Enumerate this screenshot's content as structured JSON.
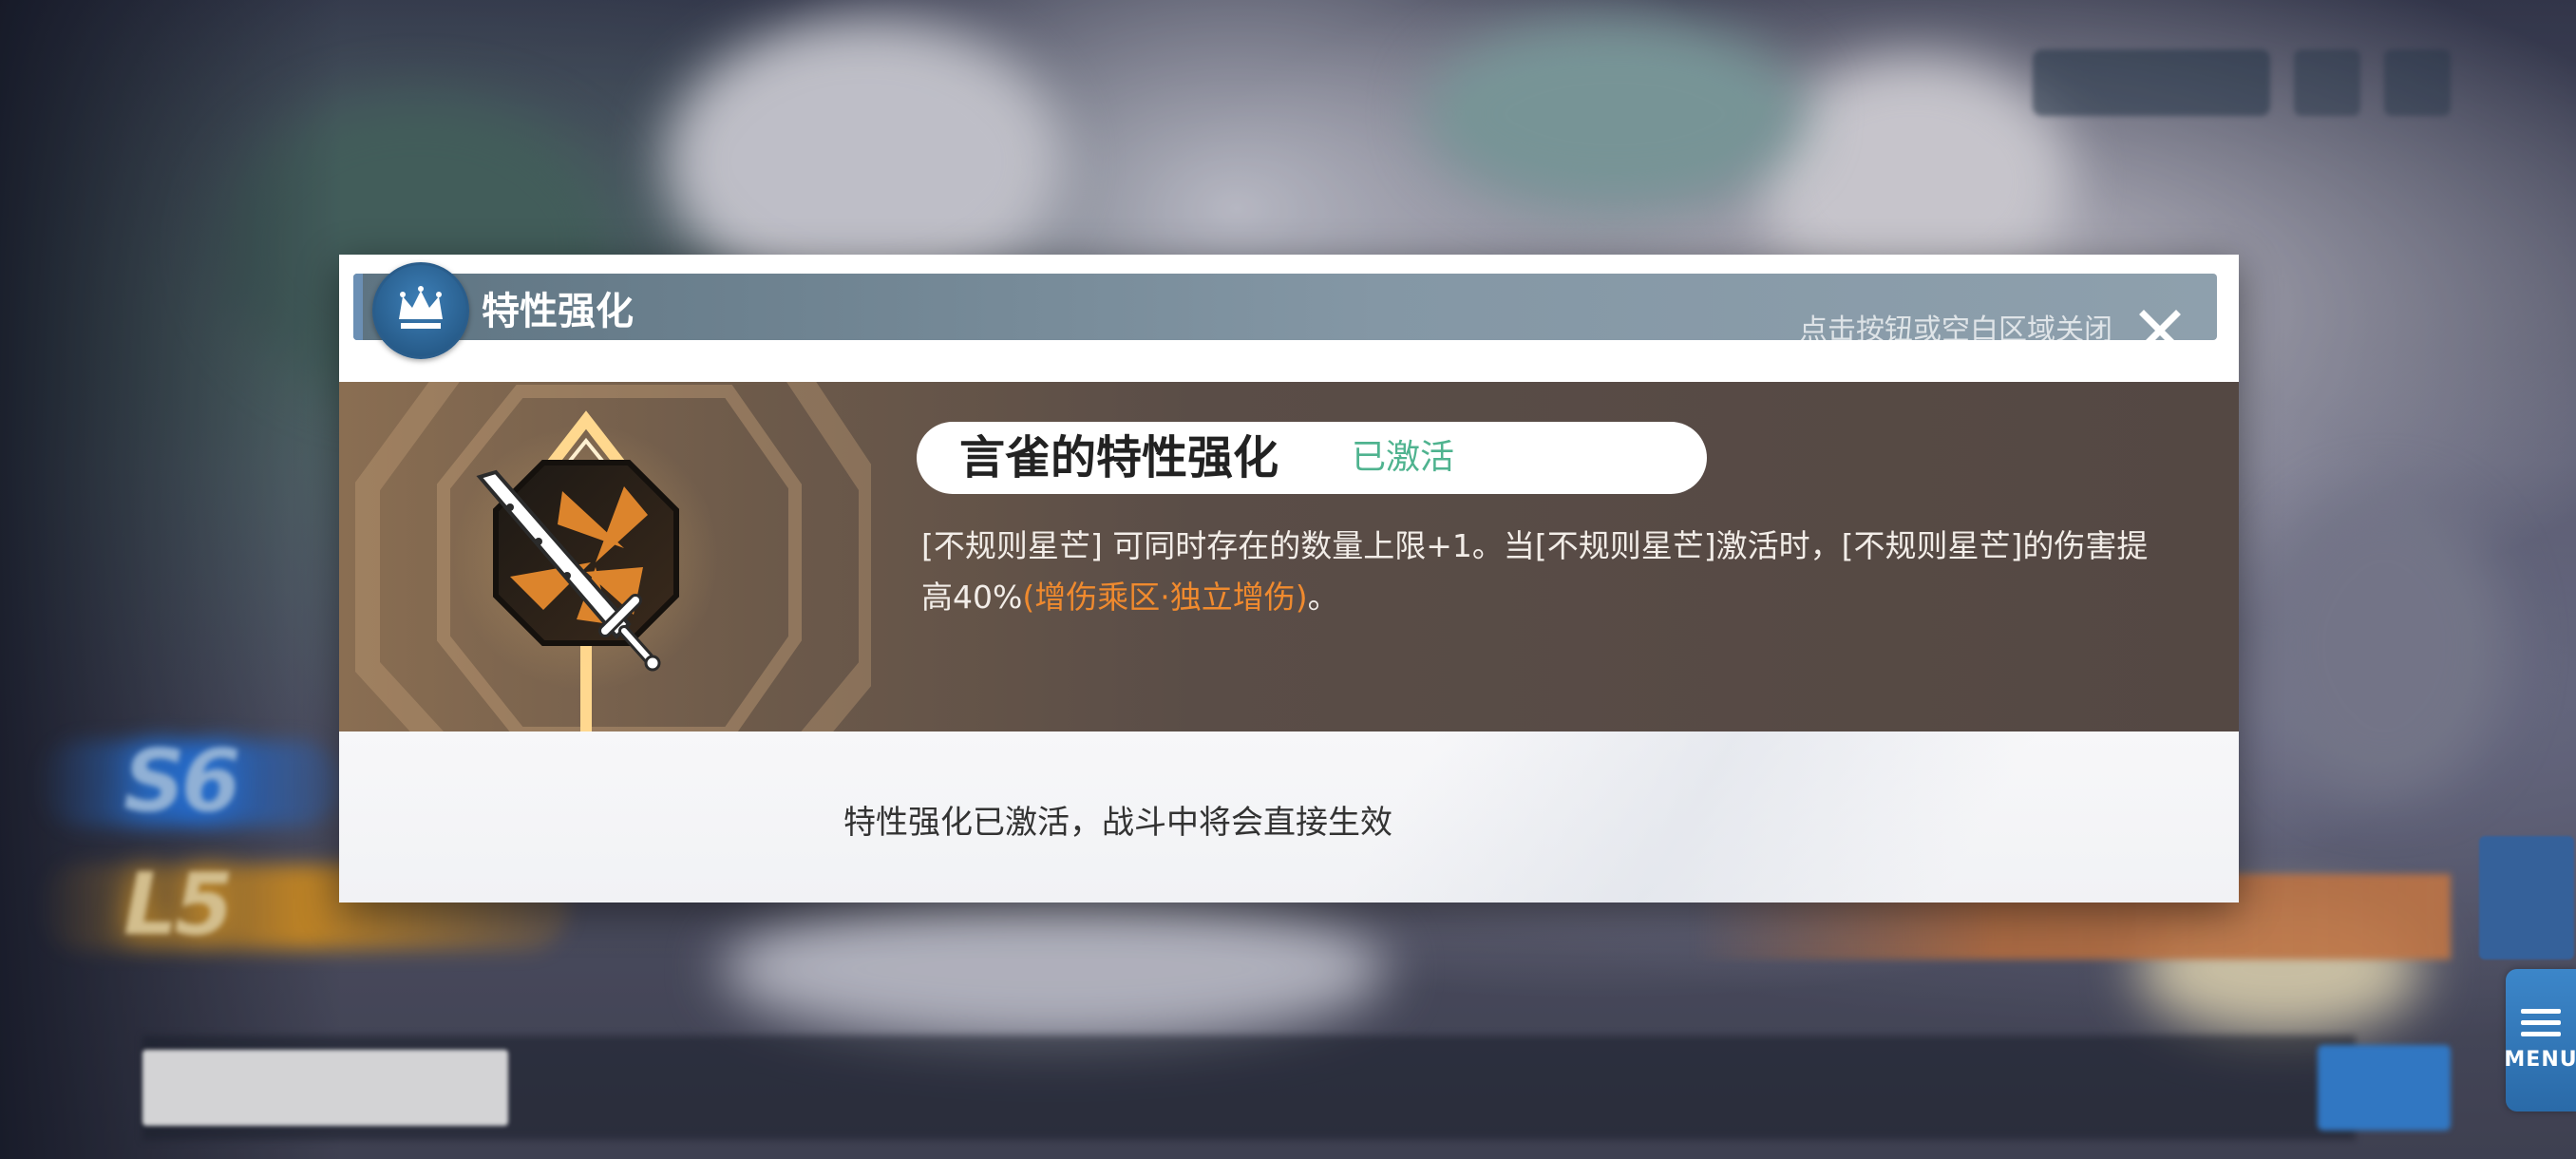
{
  "modal": {
    "title": "特性强化",
    "close_hint": "点击按钮或空白区域关闭",
    "close_icon": "close-icon",
    "header_icon": "crown-icon",
    "skill_icon": "sword-icon",
    "trait_name": "言雀的特性强化",
    "trait_status": "已激活",
    "description_part1": "[不规则星芒] 可同时存在的数量上限+1。当[不规则星芒]激活时，[不规则星芒]的伤害提高40%",
    "description_highlight": "(增伤乘区·独立增伤)",
    "description_end": "。",
    "footer_message": "特性强化已激活，战斗中将会直接生效"
  },
  "menu_button": {
    "label": "MENU",
    "icon": "hamburger-icon"
  },
  "colors": {
    "status_green": "#4fb38f",
    "highlight_orange": "#f08a2e",
    "header_blue": "#2a5d8b",
    "banner_brown": "#544843"
  }
}
